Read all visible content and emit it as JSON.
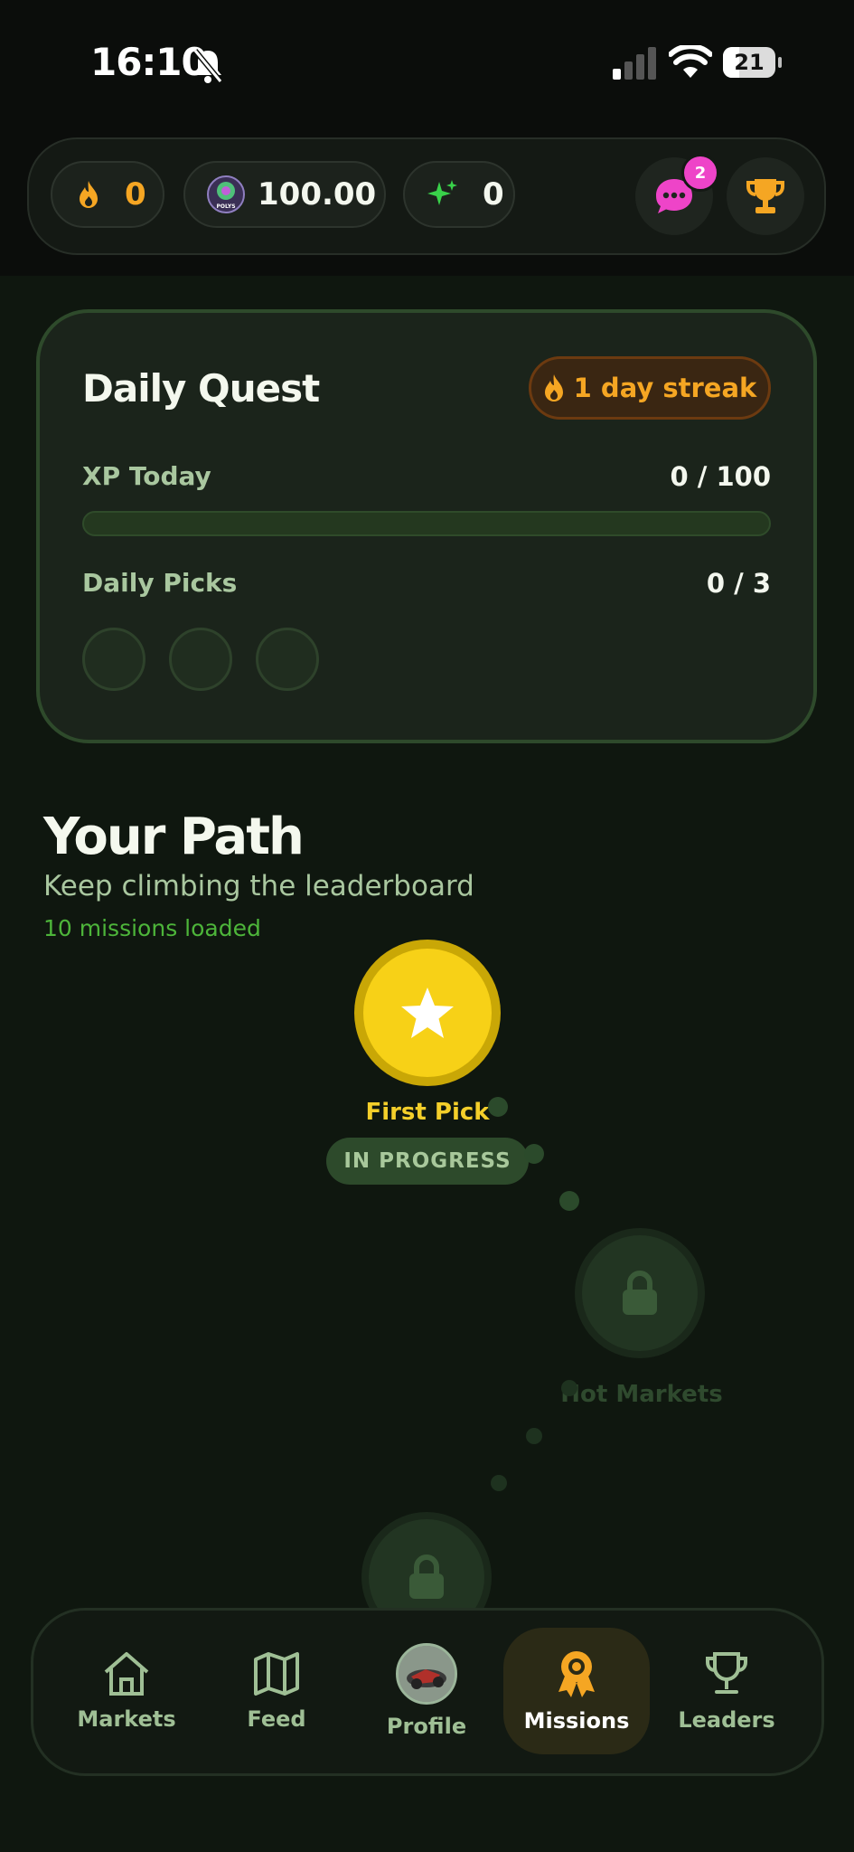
{
  "status_bar": {
    "time": "16:10",
    "battery": "21"
  },
  "top_stats": {
    "streak_count": "0",
    "coin_balance": "100.00",
    "coin_logo_text": "POLYS",
    "sparkle_count": "0",
    "chat_badge": "2"
  },
  "daily_quest": {
    "title": "Daily Quest",
    "streak_label": "1 day streak",
    "xp_label": "XP Today",
    "xp_value": "0 / 100",
    "xp_progress": 0,
    "picks_label": "Daily Picks",
    "picks_value": "0 / 3"
  },
  "path": {
    "title": "Your Path",
    "subtitle": "Keep climbing the leaderboard",
    "loaded_text": "10 missions loaded",
    "missions": [
      {
        "label": "First Pick",
        "status": "IN PROGRESS"
      },
      {
        "label": "Hot Markets",
        "status": "locked"
      }
    ]
  },
  "nav": {
    "items": [
      {
        "label": "Markets"
      },
      {
        "label": "Feed"
      },
      {
        "label": "Profile"
      },
      {
        "label": "Missions"
      },
      {
        "label": "Leaders"
      }
    ],
    "active": "Missions"
  },
  "colors": {
    "background": "#0f170f",
    "accent_gold": "#f7d117",
    "streak_orange": "#f5a623",
    "loaded_green": "#4db53a",
    "badge_pink": "#ee44c8"
  }
}
